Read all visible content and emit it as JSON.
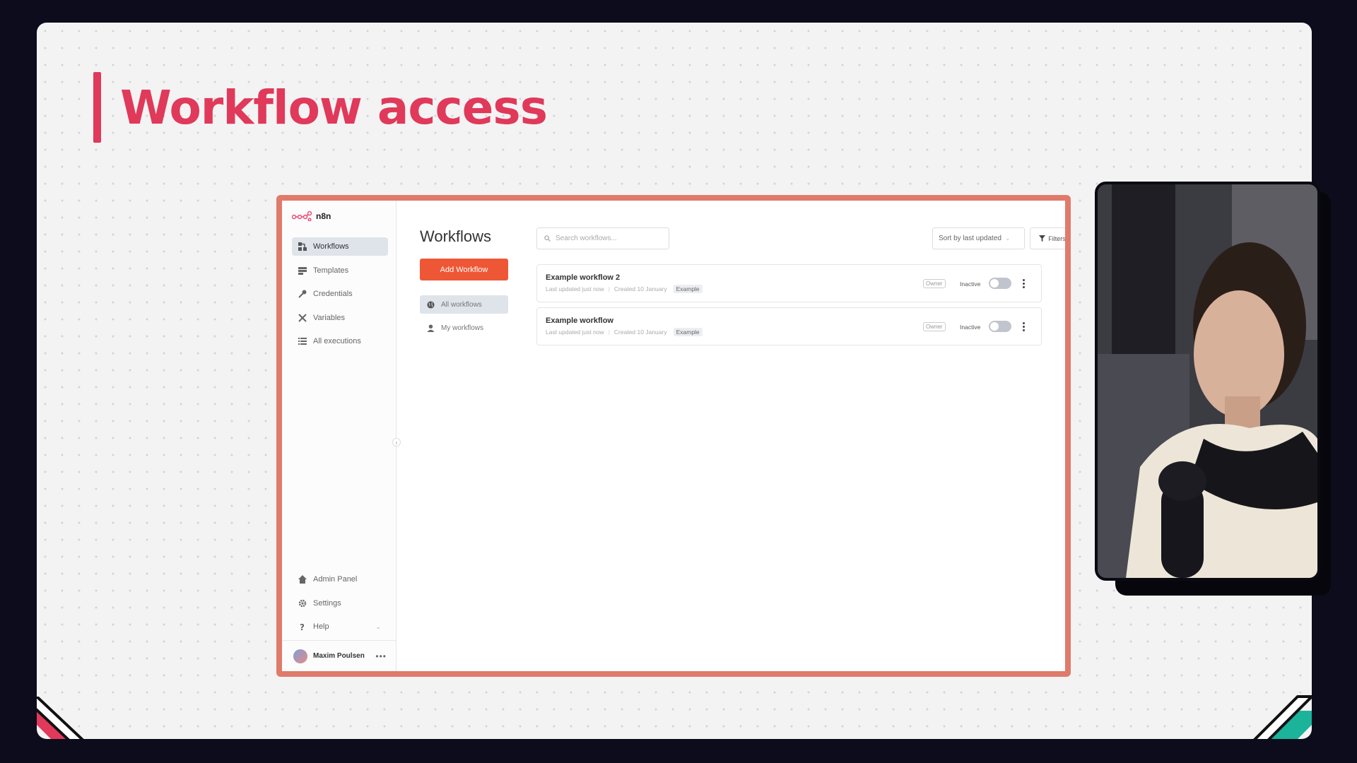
{
  "slide": {
    "title": "Workflow access"
  },
  "app": {
    "logo_text": "n8n",
    "sidebar": {
      "items": [
        {
          "label": "Workflows",
          "icon": "workflows-icon",
          "active": true
        },
        {
          "label": "Templates",
          "icon": "templates-icon",
          "active": false
        },
        {
          "label": "Credentials",
          "icon": "key-icon",
          "active": false
        },
        {
          "label": "Variables",
          "icon": "variables-icon",
          "active": false
        },
        {
          "label": "All executions",
          "icon": "list-icon",
          "active": false
        }
      ],
      "bottom_items": [
        {
          "label": "Admin Panel",
          "icon": "home-icon"
        },
        {
          "label": "Settings",
          "icon": "gear-icon"
        },
        {
          "label": "Help",
          "icon": "question-icon"
        }
      ],
      "user": {
        "name": "Maxim Poulsen",
        "menu": "•••"
      }
    },
    "main": {
      "title": "Workflows",
      "add_button": "Add Workflow",
      "filters": [
        {
          "label": "All workflows",
          "icon": "globe-icon",
          "active": true
        },
        {
          "label": "My workflows",
          "icon": "user-icon",
          "active": false
        }
      ],
      "search_placeholder": "Search workflows...",
      "sort_label": "Sort by last updated",
      "filters_button": "Filters",
      "workflows": [
        {
          "name": "Example workflow 2",
          "updated": "Last updated just now",
          "created": "Created 10 January",
          "tag": "Example",
          "role": "Owner",
          "status": "Inactive",
          "active": false
        },
        {
          "name": "Example workflow",
          "updated": "Last updated just now",
          "created": "Created 10 January",
          "tag": "Example",
          "role": "Owner",
          "status": "Inactive",
          "active": false
        }
      ]
    }
  },
  "colors": {
    "accent": "#e0395a",
    "add_button": "#ee5735",
    "frame_border": "#e07a6b",
    "teal_deco": "#1bb39a"
  }
}
